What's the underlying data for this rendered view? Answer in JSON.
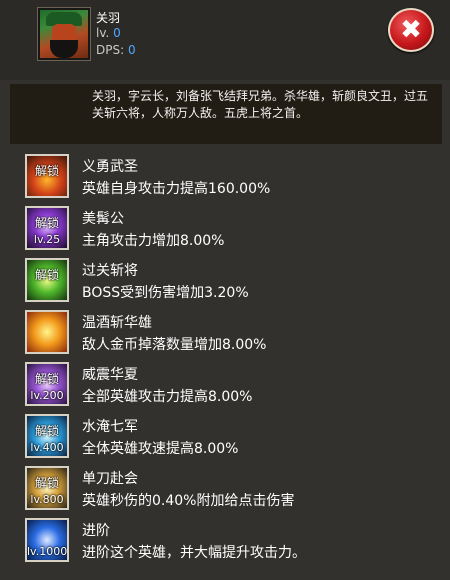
{
  "hero": {
    "name": "关羽",
    "level_label": "lv.",
    "level": "0",
    "dps_label": "DPS:",
    "dps": "0",
    "description": "关羽，字云长，刘备张飞结拜兄弟。杀华雄，斩颜良文丑，过五关斩六将，人称万人敌。五虎上将之首。"
  },
  "close_button": {
    "label": "✖"
  },
  "skills": [
    {
      "name": "义勇武圣",
      "desc": "英雄自身攻击力提高160.00%",
      "lock": "解锁",
      "req": ""
    },
    {
      "name": "美髯公",
      "desc": "主角攻击力增加8.00%",
      "lock": "解锁",
      "req": "lv.25"
    },
    {
      "name": "过关斩将",
      "desc": "BOSS受到伤害增加3.20%",
      "lock": "解锁",
      "req": ""
    },
    {
      "name": "温酒斩华雄",
      "desc": "敌人金币掉落数量增加8.00%",
      "lock": "",
      "req": ""
    },
    {
      "name": "威震华夏",
      "desc": "全部英雄攻击力提高8.00%",
      "lock": "解锁",
      "req": "lv.200"
    },
    {
      "name": "水淹七军",
      "desc": "全体英雄攻速提高8.00%",
      "lock": "解锁",
      "req": "lv.400"
    },
    {
      "name": "单刀赴会",
      "desc": "英雄秒伤的0.40%附加给点击伤害",
      "lock": "解锁",
      "req": "lv.800"
    },
    {
      "name": "进阶",
      "desc": "进阶这个英雄，并大幅提升攻击力。",
      "lock": "",
      "req": "lv.1000"
    }
  ]
}
